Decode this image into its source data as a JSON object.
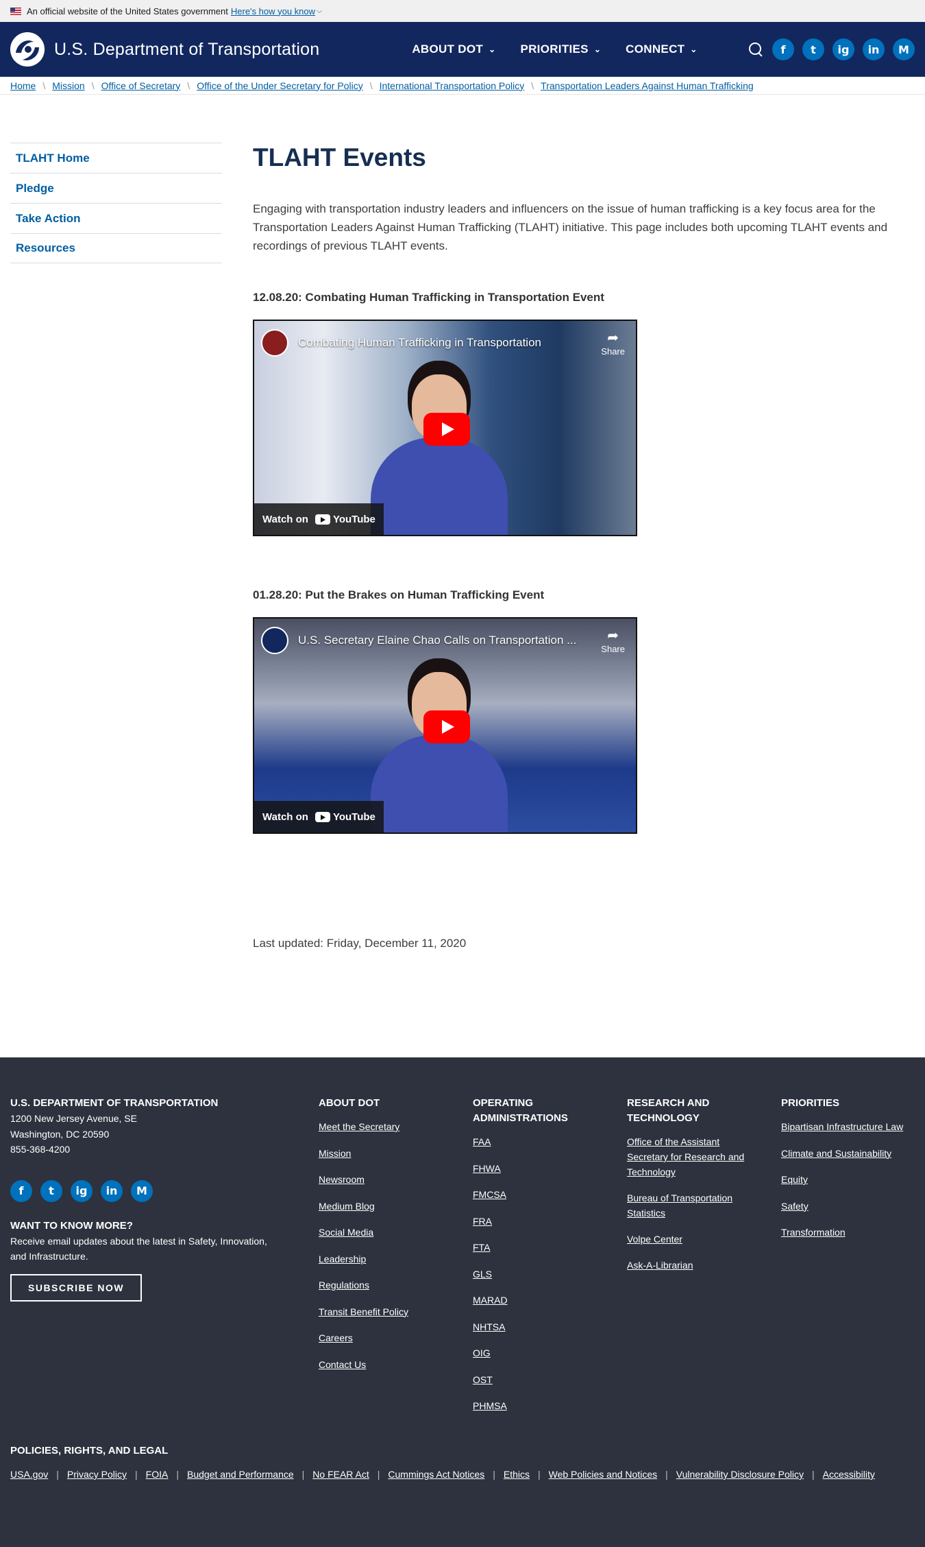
{
  "gov_banner": {
    "text": "An official website of the United States government",
    "link": "Here's how you know"
  },
  "header": {
    "title": "U.S. Department of Transportation",
    "nav": [
      "ABOUT DOT",
      "PRIORITIES",
      "CONNECT"
    ],
    "socials": [
      "f",
      "t",
      "ig",
      "in",
      "M"
    ]
  },
  "breadcrumb": [
    "Home",
    "Mission",
    "Office of Secretary",
    "Office of the Under Secretary for Policy",
    "International Transportation Policy",
    "Transportation Leaders Against Human Trafficking"
  ],
  "sidebar": {
    "items": [
      "TLAHT Home",
      "Pledge",
      "Take Action",
      "Resources"
    ]
  },
  "main": {
    "title": "TLAHT Events",
    "intro": "Engaging with transportation industry leaders and influencers on the issue of human trafficking is a key focus area for the Transportation Leaders Against Human Trafficking (TLAHT) initiative.  This page includes both upcoming TLAHT events and recordings of previous TLAHT events.",
    "events": [
      {
        "heading": "12.08.20: Combating Human Trafficking in Transportation Event",
        "video_title": "Combating Human Trafficking in Transportation",
        "share": "Share",
        "watch": "Watch on",
        "yt": "YouTube"
      },
      {
        "heading": "01.28.20: Put the Brakes on Human Trafficking Event",
        "video_title": "U.S. Secretary Elaine Chao Calls on Transportation ...",
        "share": "Share",
        "watch": "Watch on",
        "yt": "YouTube"
      }
    ],
    "last_updated": "Last updated: Friday, December 11, 2020"
  },
  "footer": {
    "org": {
      "name": "U.S. DEPARTMENT OF TRANSPORTATION",
      "address1": "1200 New Jersey Avenue, SE",
      "address2": "Washington, DC 20590",
      "phone": "855-368-4200"
    },
    "want_more": {
      "heading": "WANT TO KNOW MORE?",
      "text": "Receive email updates about the latest in Safety, Innovation, and Infrastructure.",
      "button": "SUBSCRIBE NOW"
    },
    "about": {
      "heading": "ABOUT DOT",
      "links": [
        "Meet the Secretary",
        "Mission",
        "Newsroom",
        "Medium Blog",
        "Social Media",
        "Leadership",
        "Regulations",
        "Transit Benefit Policy",
        "Careers",
        "Contact Us"
      ]
    },
    "operating": {
      "heading": "OPERATING ADMINISTRATIONS",
      "links": [
        "FAA",
        "FHWA",
        "FMCSA",
        "FRA",
        "FTA",
        "GLS",
        "MARAD",
        "NHTSA",
        "OIG",
        "OST",
        "PHMSA"
      ]
    },
    "research": {
      "heading": "RESEARCH AND TECHNOLOGY",
      "links": [
        "Office of the Assistant Secretary for Research and Technology",
        "Bureau of Transportation Statistics",
        "Volpe Center",
        "Ask-A-Librarian"
      ]
    },
    "priorities": {
      "heading": "PRIORITIES",
      "links": [
        "Bipartisan Infrastructure Law",
        "Climate and Sustainability",
        "Equity",
        "Safety",
        "Transformation"
      ]
    },
    "legal": {
      "heading": "POLICIES, RIGHTS, AND LEGAL",
      "links": [
        "USA.gov",
        "Privacy Policy",
        "FOIA",
        "Budget and Performance",
        "No FEAR Act",
        "Cummings Act Notices",
        "Ethics",
        "Web Policies and Notices",
        "Vulnerability Disclosure Policy",
        "Accessibility"
      ]
    }
  }
}
